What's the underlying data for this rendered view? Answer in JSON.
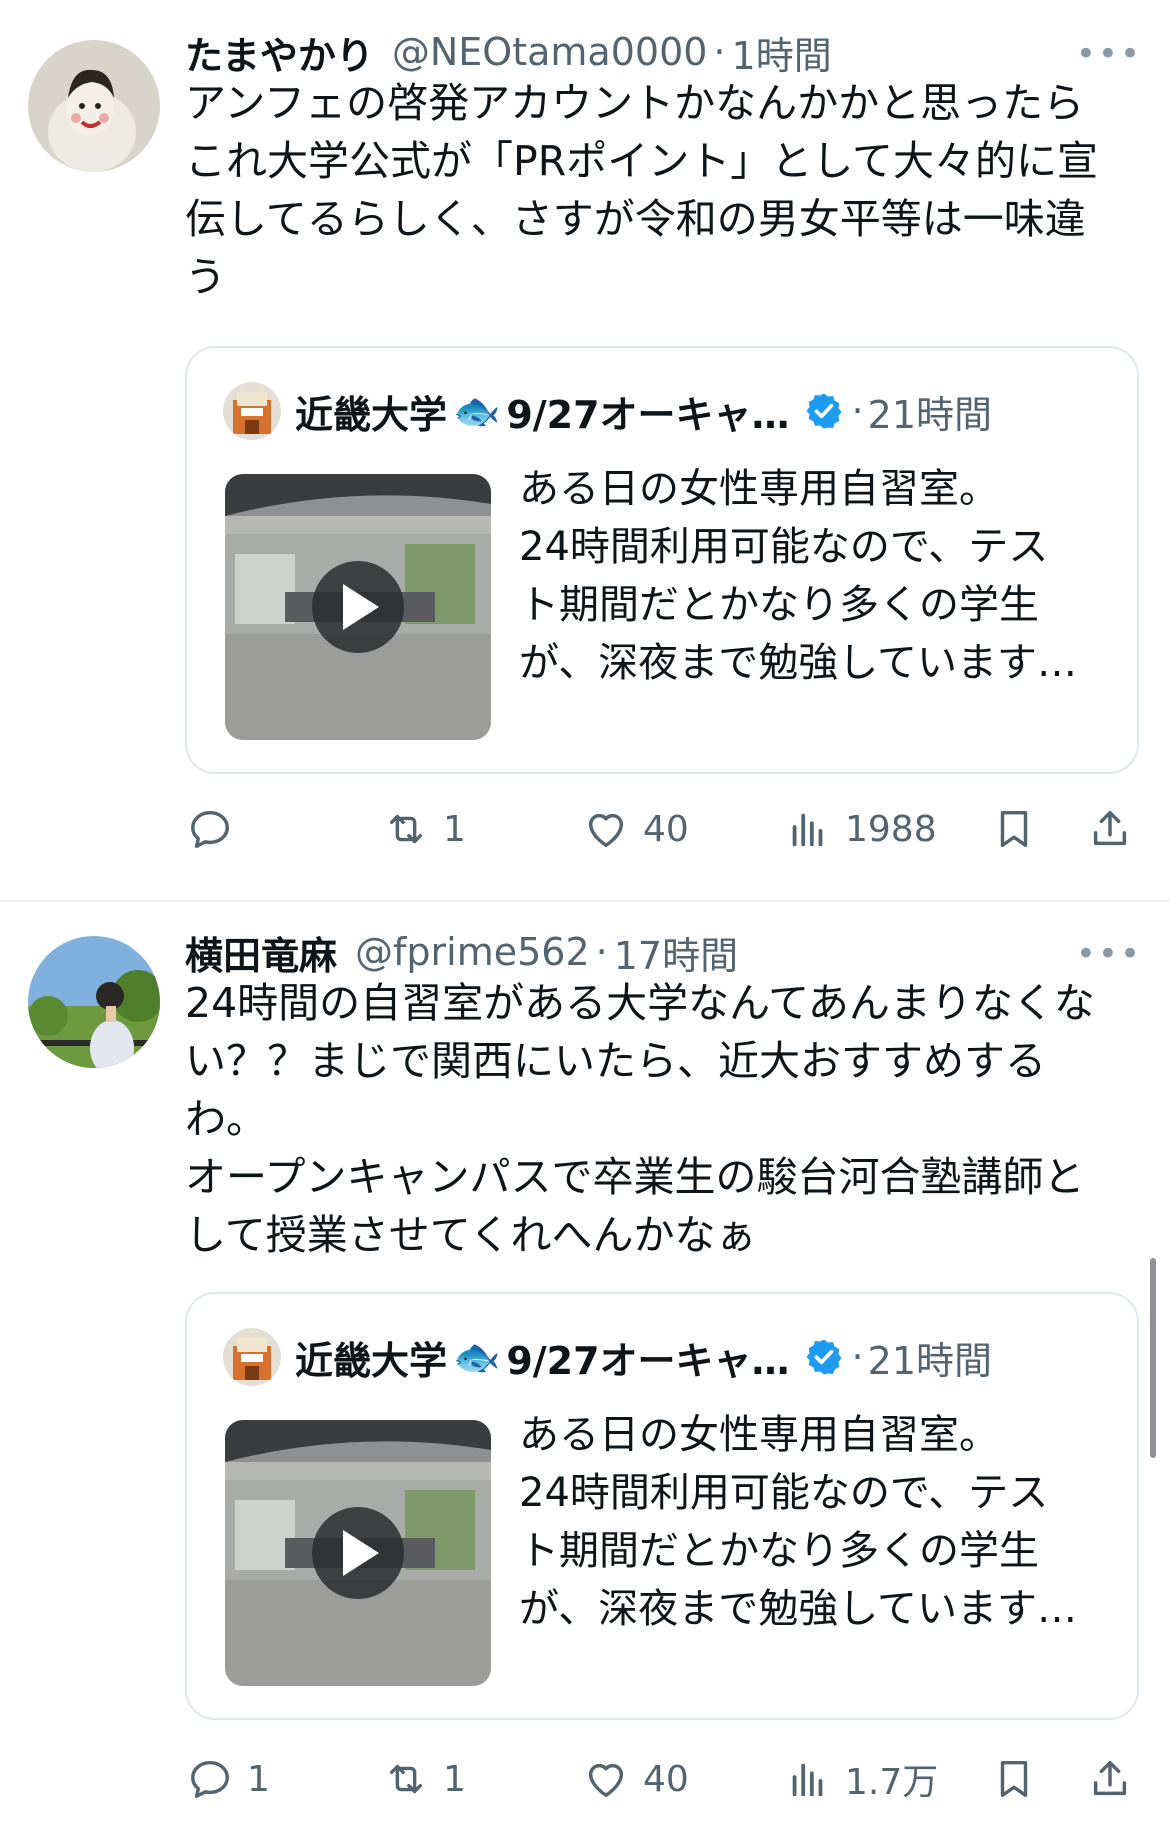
{
  "tweets": [
    {
      "name": "たまやかり",
      "handle": "@NEOtama0000",
      "time": "1時間",
      "more": "•••",
      "lines": [
        "アンフェの啓発アカウントかなんかかと思ったら",
        "これ大学公式が「PRポイント」として大々的に宣",
        "伝してるらしく、さすが令和の男女平等は一味違",
        "う"
      ],
      "quote": {
        "name": "近畿大学",
        "fish": "🐟",
        "name_suffix": "9/27オーキャ…",
        "time": "21時間",
        "lines": [
          "ある日の女性専用自習室。",
          "24時間利用可能なので、テス",
          "ト期間だとかなり多くの学生",
          "が、深夜まで勉強しています…"
        ]
      },
      "actions": {
        "reply": "",
        "retweet": "1",
        "like": "40",
        "views": "1988"
      }
    },
    {
      "name": "横田竜麻",
      "handle": "@fprime562",
      "time": "17時間",
      "more": "•••",
      "lines": [
        "24時間の自習室がある大学なんてあんまりなくな",
        "い？？まじで関西にいたら、近大おすすめする",
        "わ。",
        "オープンキャンパスで卒業生の駿台河合塾講師と",
        "して授業させてくれへんかなぁ"
      ],
      "quote": {
        "name": "近畿大学",
        "fish": "🐟",
        "name_suffix": "9/27オーキャ…",
        "time": "21時間",
        "lines": [
          "ある日の女性専用自習室。",
          "24時間利用可能なので、テス",
          "ト期間だとかなり多くの学生",
          "が、深夜まで勉強しています…"
        ]
      },
      "actions": {
        "reply": "1",
        "retweet": "1",
        "like": "40",
        "views": "1.7万"
      }
    }
  ],
  "separator": "·",
  "icons": [
    "reply-icon",
    "retweet-icon",
    "like-icon",
    "views-icon",
    "bookmark-icon",
    "share-icon",
    "verified-badge-icon",
    "play-icon"
  ],
  "colors": {
    "text": "#0f1419",
    "secondary": "#536471",
    "verified": "#1d9bf0",
    "border": "#e1e8ed"
  }
}
